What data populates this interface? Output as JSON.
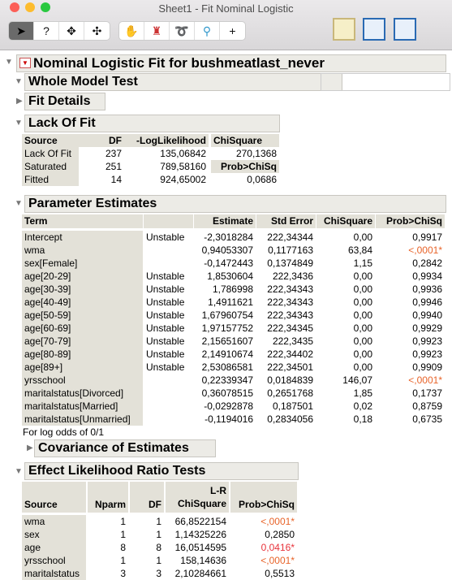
{
  "window": {
    "title": "Sheet1 - Fit Nominal Logistic"
  },
  "toolbar": {
    "tools": [
      "arrow-icon",
      "help-icon",
      "crosshair-icon",
      "move-icon",
      "hand-icon",
      "brush-icon",
      "lasso-icon",
      "magnifier-icon",
      "xy-crosshair-icon"
    ],
    "selected": "arrow-icon"
  },
  "report": {
    "title": "Nominal Logistic Fit for bushmeatlast_never",
    "whole_model": "Whole Model Test",
    "fit_details": "Fit Details",
    "lack_of_fit": {
      "title": "Lack Of Fit",
      "headers": [
        "Source",
        "DF",
        "-LogLikelihood",
        "ChiSquare"
      ],
      "rows": [
        [
          "Lack Of Fit",
          "237",
          "135,06842",
          "270,1368"
        ],
        [
          "Saturated",
          "251",
          "789,58160",
          "Prob>ChiSq"
        ],
        [
          "Fitted",
          "14",
          "924,65002",
          "0,0686"
        ]
      ]
    },
    "param": {
      "title": "Parameter Estimates",
      "headers": [
        "Term",
        "",
        "Estimate",
        "Std Error",
        "ChiSquare",
        "Prob>ChiSq"
      ],
      "rows": [
        [
          "Intercept",
          "Unstable",
          "-2,3018284",
          "222,34344",
          "0,00",
          "0,9917"
        ],
        [
          "wma",
          "",
          "0,94053307",
          "0,1177163",
          "63,84",
          "<,0001*"
        ],
        [
          "sex[Female]",
          "",
          "-0,1472443",
          "0,1374849",
          "1,15",
          "0,2842"
        ],
        [
          "age[20-29]",
          "Unstable",
          "1,8530604",
          "222,3436",
          "0,00",
          "0,9934"
        ],
        [
          "age[30-39]",
          "Unstable",
          "1,786998",
          "222,34343",
          "0,00",
          "0,9936"
        ],
        [
          "age[40-49]",
          "Unstable",
          "1,4911621",
          "222,34343",
          "0,00",
          "0,9946"
        ],
        [
          "age[50-59]",
          "Unstable",
          "1,67960754",
          "222,34343",
          "0,00",
          "0,9940"
        ],
        [
          "age[60-69]",
          "Unstable",
          "1,97157752",
          "222,34345",
          "0,00",
          "0,9929"
        ],
        [
          "age[70-79]",
          "Unstable",
          "2,15651607",
          "222,3435",
          "0,00",
          "0,9923"
        ],
        [
          "age[80-89]",
          "Unstable",
          "2,14910674",
          "222,34402",
          "0,00",
          "0,9923"
        ],
        [
          "age[89+]",
          "Unstable",
          "2,53086581",
          "222,34501",
          "0,00",
          "0,9909"
        ],
        [
          "yrsschool",
          "",
          "0,22339347",
          "0,0184839",
          "146,07",
          "<,0001*"
        ],
        [
          "maritalstatus[Divorced]",
          "",
          "0,36078515",
          "0,2651768",
          "1,85",
          "0,1737"
        ],
        [
          "maritalstatus[Married]",
          "",
          "-0,0292878",
          "0,187501",
          "0,02",
          "0,8759"
        ],
        [
          "maritalstatus[Unmarried]",
          "",
          "-0,1194016",
          "0,2834056",
          "0,18",
          "0,6735"
        ]
      ],
      "note": "For log odds of 0/1"
    },
    "covariance": "Covariance of Estimates",
    "effect_lr": {
      "title": "Effect Likelihood Ratio Tests",
      "headers": [
        "Source",
        "Nparm",
        "DF",
        "L-R",
        "ChiSquare",
        "Prob>ChiSq"
      ],
      "rows": [
        [
          "wma",
          "1",
          "1",
          "66,8522154",
          "<,0001*"
        ],
        [
          "sex",
          "1",
          "1",
          "1,14325226",
          "0,2850"
        ],
        [
          "age",
          "8",
          "8",
          "16,0514595",
          "0,0416*"
        ],
        [
          "yrsschool",
          "1",
          "1",
          "158,14636",
          "<,0001*"
        ],
        [
          "maritalstatus",
          "3",
          "3",
          "2,10284661",
          "0,5513"
        ]
      ]
    }
  },
  "colors": {
    "significant": "#e8642a",
    "significant_alt": "#e8323a",
    "header_bg": "#e3e1d8"
  }
}
